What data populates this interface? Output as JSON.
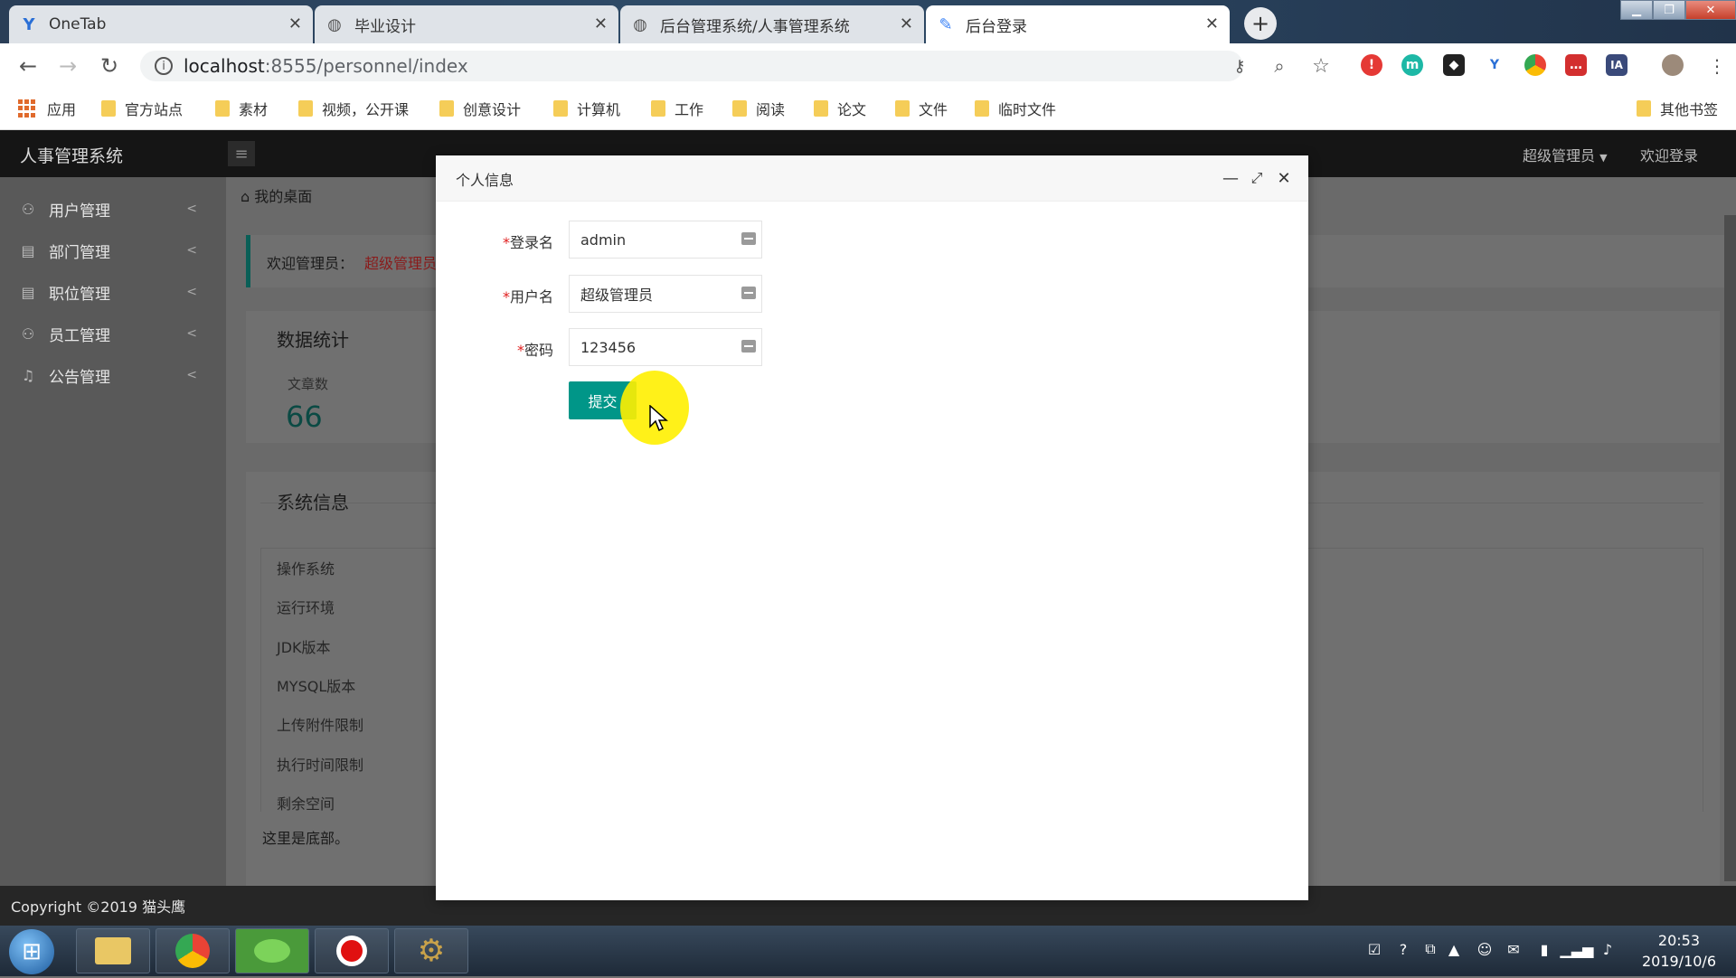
{
  "browser": {
    "tabs": [
      {
        "title": "OneTab",
        "icon": "onetab-icon"
      },
      {
        "title": "毕业设计",
        "icon": "globe-icon"
      },
      {
        "title": "后台管理系统/人事管理系统",
        "icon": "globe-icon"
      },
      {
        "title": "后台登录",
        "icon": "pin-icon"
      }
    ],
    "url_host": "localhost",
    "url_rest": ":8555/personnel/index",
    "bookmarks": [
      "应用",
      "官方站点",
      "素材",
      "视频，公开课",
      "创意设计",
      "计算机",
      "工作",
      "阅读",
      "论文",
      "文件",
      "临时文件"
    ],
    "other_bookmarks": "其他书签"
  },
  "app": {
    "title": "人事管理系统",
    "user_menu": "超级管理员",
    "welcome_link": "欢迎登录",
    "breadcrumb": "我的桌面",
    "sidebar": [
      {
        "label": "用户管理",
        "icon": "user-icon"
      },
      {
        "label": "部门管理",
        "icon": "document-icon"
      },
      {
        "label": "职位管理",
        "icon": "document-icon"
      },
      {
        "label": "员工管理",
        "icon": "user-icon"
      },
      {
        "label": "公告管理",
        "icon": "bell-icon"
      }
    ],
    "welcome_prefix": "欢迎管理员：",
    "welcome_name": "超级管理员",
    "stats_title": "数据统计",
    "stat_label": "文章数",
    "stat_value": "66",
    "sysinfo_title": "系统信息",
    "sysinfo_rows": [
      "操作系统",
      "运行环境",
      "JDK版本",
      "MYSQL版本",
      "上传附件限制",
      "执行时间限制",
      "剩余空间"
    ],
    "bottom_note": "这里是底部。",
    "copyright": "Copyright ©2019 猫头鹰"
  },
  "dialog": {
    "title": "个人信息",
    "fields": [
      {
        "label": "登录名",
        "value": "admin"
      },
      {
        "label": "用户名",
        "value": "超级管理员"
      },
      {
        "label": "密码",
        "value": "123456"
      }
    ],
    "submit_label": "提交"
  },
  "taskbar": {
    "time": "20:53",
    "date": "2019/10/6"
  },
  "colors": {
    "accent": "#009688",
    "highlight": "#fff000",
    "required": "#e02020"
  }
}
